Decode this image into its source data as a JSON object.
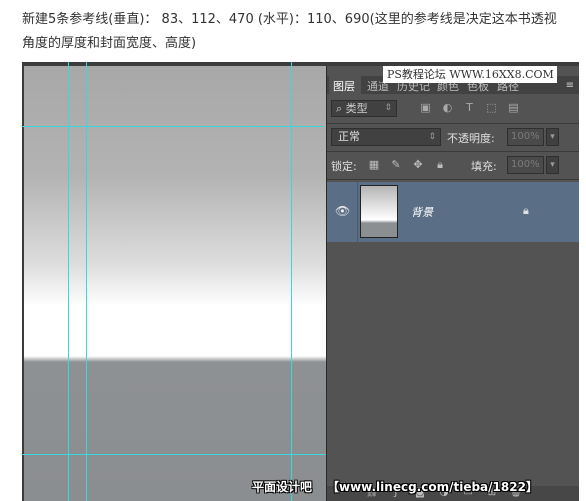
{
  "article": {
    "line1": "新建5条参考线(垂直)： 83、112、470 (水平)：110、690(这里的参考线是决定这本书透视",
    "line2": "角度的厚度和封面宽度、高度)"
  },
  "colors": {
    "guide": "#3ad7de",
    "panel_bg": "#535353",
    "selected_layer": "#5a6e86",
    "canvas_top": "#a8a8a8",
    "canvas_bottom": "#8b8e91"
  },
  "watermark_top": "PS教程论坛 WWW.16XX8.COM",
  "panel": {
    "tabs": [
      "图层",
      "通道",
      "历史记",
      "颜色",
      "色板",
      "路径"
    ],
    "menu_icon": "panel-menu-icon",
    "filter": {
      "kind_label": "类型",
      "icons": [
        "image-filter-icon",
        "adjustment-filter-icon",
        "text-filter-icon",
        "shape-filter-icon",
        "smart-object-filter-icon"
      ]
    },
    "blend_mode": "正常",
    "opacity_label": "不透明度:",
    "opacity_value": "100%",
    "lock_label": "锁定:",
    "lock_icons": [
      "lock-transparent-icon",
      "lock-pixels-icon",
      "lock-position-icon",
      "lock-all-icon"
    ],
    "fill_label": "填充:",
    "fill_value": "100%",
    "layer": {
      "name": "背景",
      "visible": true,
      "locked": true
    },
    "bottom_icons": [
      "link-icon",
      "fx-icon",
      "mask-icon",
      "adjustment-icon",
      "group-icon",
      "new-layer-icon",
      "delete-icon"
    ]
  },
  "watermark_bottom": {
    "left": "平面设计吧",
    "right": "【www.linecg.com/tieba/1822】"
  }
}
